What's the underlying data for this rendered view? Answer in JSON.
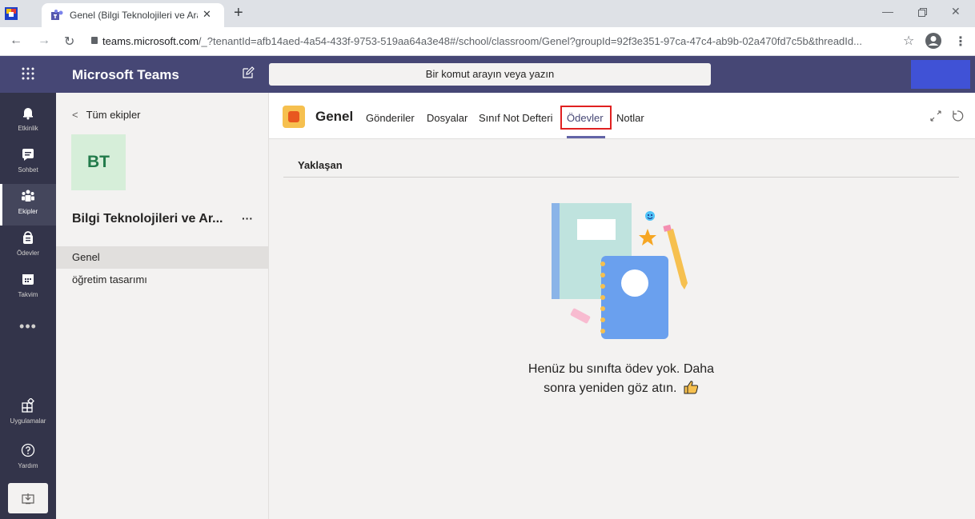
{
  "browser": {
    "tab_title": "Genel (Bilgi Teknolojileri ve Araçl",
    "tab_close": "✕",
    "new_tab": "+",
    "url_host": "teams.microsoft.com",
    "url_rest": "/_?tenantId=afb14aed-4a54-433f-9753-519aa64a3e48#/school/classroom/Genel?groupId=92f3e351-97ca-47c4-ab9b-02a470fd7c5b&threadId...",
    "icons": [
      "back-icon",
      "forward-icon",
      "reload-icon",
      "lock-icon",
      "star-icon",
      "profile-icon",
      "menu-icon"
    ]
  },
  "header": {
    "app_title": "Microsoft Teams",
    "search_placeholder": "Bir komut arayın veya yazın",
    "accent_color": "#464775"
  },
  "rail": {
    "items": [
      {
        "label": "Etkinlik",
        "icon": "bell-icon"
      },
      {
        "label": "Sohbet",
        "icon": "chat-icon"
      },
      {
        "label": "Ekipler",
        "icon": "teams-icon",
        "active": true
      },
      {
        "label": "Ödevler",
        "icon": "assignments-icon"
      },
      {
        "label": "Takvim",
        "icon": "calendar-icon"
      }
    ],
    "more": "•••",
    "apps": {
      "label": "Uygulamalar",
      "icon": "apps-icon"
    },
    "help": {
      "label": "Yardım",
      "icon": "help-icon"
    }
  },
  "team_panel": {
    "back_label": "Tüm ekipler",
    "team_initials": "BT",
    "team_name": "Bilgi Teknolojileri ve Ar...",
    "more": "···",
    "channels": [
      "Genel",
      "öğretim tasarımı"
    ]
  },
  "main": {
    "channel_title": "Genel",
    "tabs": [
      "Gönderiler",
      "Dosyalar",
      "Sınıf Not Defteri",
      "Ödevler",
      "Notlar"
    ],
    "active_tab": "Ödevler",
    "section_title": "Yaklaşan",
    "empty_line1": "Henüz bu sınıfta ödev yok. Daha",
    "empty_line2": "sonra yeniden göz atın."
  }
}
